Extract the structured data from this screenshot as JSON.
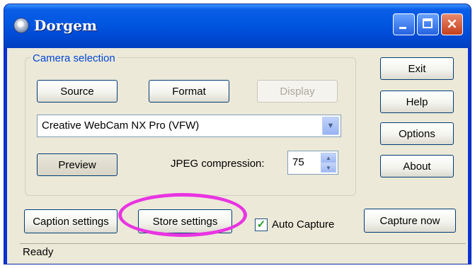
{
  "window": {
    "title": "Dorgem",
    "icon": "app-icon"
  },
  "titlebar_buttons": {
    "minimize": "minimize-icon",
    "maximize": "maximize-icon",
    "close": "×"
  },
  "camera_group": {
    "label": "Camera selection",
    "source_button": "Source",
    "format_button": "Format",
    "display_button": "Display",
    "camera_select": "Creative WebCam NX Pro (VFW)",
    "preview_button": "Preview",
    "jpeg_label": "JPEG compression:",
    "jpeg_value": "75"
  },
  "side_buttons": {
    "exit": "Exit",
    "help": "Help",
    "options": "Options",
    "about": "About"
  },
  "bottom": {
    "caption_button": "Caption settings",
    "store_button": "Store settings",
    "auto_capture_label": "Auto Capture",
    "auto_capture_checked": true,
    "capture_now_button": "Capture now"
  },
  "status": "Ready",
  "colors": {
    "title_bar": "#0054e3",
    "client_bg": "#ece9d8",
    "group_label": "#0046d5",
    "highlight_ring": "#e934e2"
  }
}
